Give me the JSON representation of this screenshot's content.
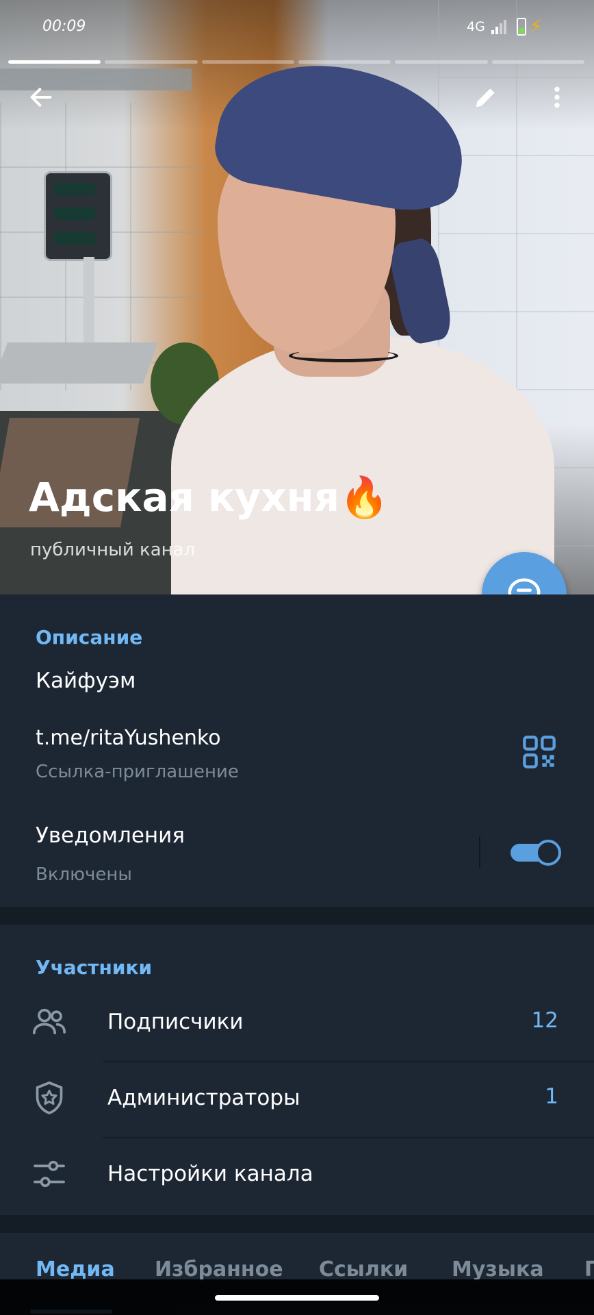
{
  "status_bar": {
    "time": "00:09",
    "network": "4G"
  },
  "story_progress": {
    "segments": 6,
    "active_segment": 1
  },
  "header": {
    "channel_name": "Адская кухня",
    "channel_emoji": "🔥",
    "subtitle": "публичный канал",
    "icons": [
      "back-arrow-icon",
      "pencil-icon",
      "more-vertical-icon",
      "chat-bubble-icon"
    ]
  },
  "info": {
    "description_label": "Описание",
    "description": "Кайфуэм",
    "link": "t.me/ritaYushenko",
    "link_caption": "Ссылка-приглашение",
    "notifications_label": "Уведомления",
    "notifications_status": "Включены",
    "notifications_enabled": true
  },
  "members": {
    "section_label": "Участники",
    "rows": [
      {
        "label": "Подписчики",
        "count": "12",
        "icon": "people-icon"
      },
      {
        "label": "Администраторы",
        "count": "1",
        "icon": "shield-star-icon"
      },
      {
        "label": "Настройки канала",
        "count": "",
        "icon": "sliders-icon"
      }
    ]
  },
  "tabs": {
    "items": [
      "Медиа",
      "Избранное",
      "Ссылки",
      "Музыка",
      "Г"
    ],
    "active": "Медиа"
  },
  "colors": {
    "accent": "#71b8f5",
    "fab": "#5a9fe0",
    "background": "#1d2733",
    "separator": "#141c25",
    "secondary_text": "#7d8b99"
  }
}
